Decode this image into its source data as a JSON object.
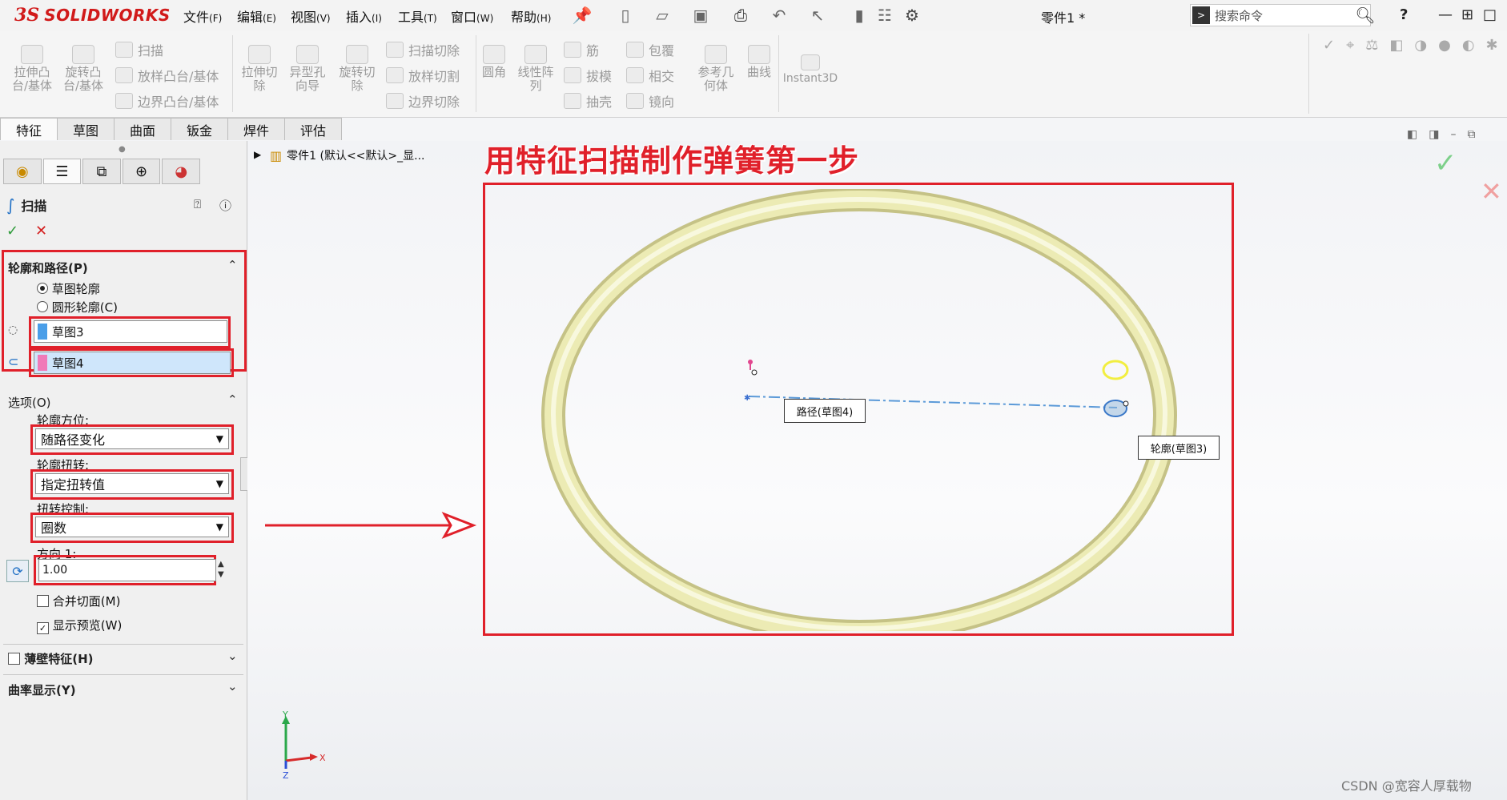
{
  "app": {
    "logo_mark": "3S",
    "logo_text": "SOLIDWORKS",
    "doc_title": "零件1 *"
  },
  "menu": [
    {
      "label": "文件",
      "key": "(F)"
    },
    {
      "label": "编辑",
      "key": "(E)"
    },
    {
      "label": "视图",
      "key": "(V)"
    },
    {
      "label": "插入",
      "key": "(I)"
    },
    {
      "label": "工具",
      "key": "(T)"
    },
    {
      "label": "窗口",
      "key": "(W)"
    },
    {
      "label": "帮助",
      "key": "(H)"
    }
  ],
  "search": {
    "placeholder": "搜索命令"
  },
  "ribbon": {
    "extrude_boss": "拉伸凸台/基体",
    "revolve_boss": "旋转凸台/基体",
    "sweep": "扫描",
    "loft_boss": "放样凸台/基体",
    "boundary_boss": "边界凸台/基体",
    "extrude_cut": "拉伸切除",
    "hole_wizard": "异型孔向导",
    "revolve_cut": "旋转切除",
    "sweep_cut": "扫描切除",
    "loft_cut": "放样切割",
    "boundary_cut": "边界切除",
    "fillet": "圆角",
    "linear_pattern": "线性阵列",
    "rib": "筋",
    "draft": "拔模",
    "shell": "抽壳",
    "wrap": "包覆",
    "intersect": "相交",
    "mirror": "镜向",
    "ref_geometry": "参考几何体",
    "curves": "曲线",
    "instant3d": "Instant3D"
  },
  "tabs": [
    "特征",
    "草图",
    "曲面",
    "钣金",
    "焊件",
    "评估"
  ],
  "panel": {
    "title": "扫描",
    "profile_path": {
      "title": "轮廓和路径(P)",
      "sketch_profile": "草图轮廓",
      "circular_profile": "圆形轮廓(C)",
      "profile_value": "草图3",
      "path_value": "草图4"
    },
    "options": {
      "title": "选项(O)",
      "orientation_label": "轮廓方位:",
      "orientation_value": "随路径变化",
      "twist_label": "轮廓扭转:",
      "twist_value": "指定扭转值",
      "twist_control_label": "扭转控制:",
      "twist_control_value": "圈数",
      "direction_label": "方向 1:",
      "direction_value": "1.00",
      "merge_faces": "合并切面(M)",
      "show_preview": "显示预览(W)"
    },
    "thin_feature": "薄壁特征(H)",
    "curvature_display": "曲率显示(Y)"
  },
  "tree": {
    "part_label": "零件1 (默认<<默认>_显..."
  },
  "annotations": {
    "title": "用特征扫描制作弹簧第一步",
    "circle": "圆",
    "line": "直线"
  },
  "callouts": {
    "path": "路径(草图4)",
    "profile": "轮廓(草图3)"
  },
  "triad": {
    "y": "Y",
    "x": "X",
    "z": "Z"
  },
  "watermark": "CSDN @宽容人厚载物",
  "colors": {
    "annotation_red": "#e0202a",
    "ring": "#ecebb4",
    "path_line": "#5b9ad8"
  }
}
